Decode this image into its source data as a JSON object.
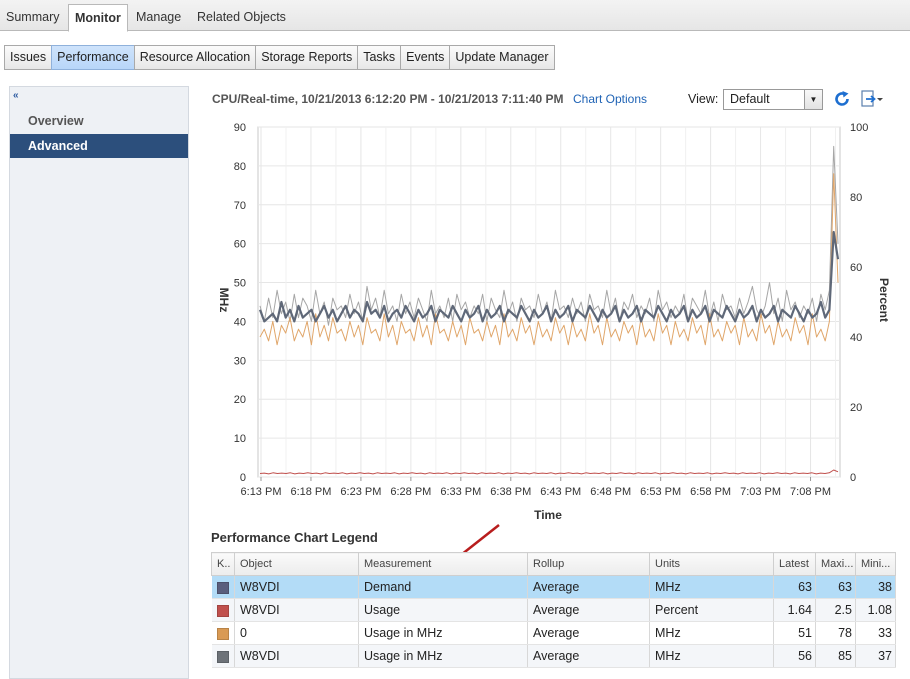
{
  "top_tabs": [
    "Summary",
    "Monitor",
    "Manage",
    "Related Objects"
  ],
  "sub_tabs": [
    "Issues",
    "Performance",
    "Resource Allocation",
    "Storage Reports",
    "Tasks",
    "Events",
    "Update Manager"
  ],
  "left_nav": {
    "collapse_glyph": "«",
    "items": [
      "Overview",
      "Advanced"
    ]
  },
  "chart_header": {
    "title": "CPU/Real-time, 10/21/2013 6:12:20 PM - 10/21/2013 7:11:40 PM",
    "options_link": "Chart Options",
    "view_label": "View:",
    "view_value": "Default",
    "icons": [
      "refresh-icon",
      "export-icon"
    ]
  },
  "legend": {
    "title": "Performance Chart Legend",
    "columns": [
      "K..",
      "Object",
      "Measurement",
      "Rollup",
      "Units",
      "Latest",
      "Maxi...",
      "Mini..."
    ],
    "rows": [
      {
        "color": "#5a5e7d",
        "object": "W8VDI",
        "measurement": "Demand",
        "rollup": "Average",
        "units": "MHz",
        "latest": "63",
        "max": "63",
        "min": "38"
      },
      {
        "color": "#c0504d",
        "object": "W8VDI",
        "measurement": "Usage",
        "rollup": "Average",
        "units": "Percent",
        "latest": "1.64",
        "max": "2.5",
        "min": "1.08"
      },
      {
        "color": "#d99a54",
        "object": "0",
        "measurement": "Usage in MHz",
        "rollup": "Average",
        "units": "MHz",
        "latest": "51",
        "max": "78",
        "min": "33"
      },
      {
        "color": "#6d7278",
        "object": "W8VDI",
        "measurement": "Usage in MHz",
        "rollup": "Average",
        "units": "MHz",
        "latest": "56",
        "max": "85",
        "min": "37"
      }
    ]
  },
  "chart_data": {
    "type": "line",
    "xlabel": "Time",
    "ylabel": "MHz",
    "y2label": "Percent",
    "ylim": [
      0,
      90
    ],
    "yticks": [
      0,
      10,
      20,
      30,
      40,
      50,
      60,
      70,
      80,
      90
    ],
    "y2lim": [
      0,
      100
    ],
    "y2ticks": [
      0,
      20,
      40,
      60,
      80,
      100
    ],
    "xticks": [
      "6:13 PM",
      "6:18 PM",
      "6:23 PM",
      "6:28 PM",
      "6:33 PM",
      "6:38 PM",
      "6:43 PM",
      "6:48 PM",
      "6:53 PM",
      "6:58 PM",
      "7:03 PM",
      "7:08 PM"
    ],
    "grid": true,
    "series": [
      {
        "color": "#a6a6a6",
        "values": [
          44,
          40,
          46,
          41,
          48,
          42,
          45,
          40,
          47,
          41,
          46,
          44,
          40,
          48,
          42,
          45,
          39,
          46,
          43,
          44,
          41,
          47,
          42,
          45,
          40,
          49,
          43,
          46,
          41,
          48,
          42,
          44,
          40,
          47,
          42,
          45,
          41,
          46,
          43,
          40,
          48,
          42,
          44,
          41,
          46,
          40,
          47,
          43,
          45,
          41,
          44,
          42,
          47,
          40,
          46,
          43,
          41,
          48,
          42,
          45,
          40,
          46,
          43,
          44,
          41,
          47,
          42,
          45,
          40,
          48,
          43,
          44,
          41,
          46,
          42,
          45,
          40,
          47,
          43,
          44,
          41,
          48,
          42,
          46,
          40,
          45,
          43,
          47,
          41,
          44,
          42,
          46,
          40,
          48,
          43,
          45,
          41,
          44,
          42,
          47,
          40,
          46,
          44,
          42,
          48,
          41,
          45,
          40,
          47,
          43,
          44,
          41,
          46,
          42,
          45,
          49,
          43,
          41,
          44,
          50,
          42,
          46,
          40,
          48,
          43,
          45,
          41,
          44,
          42,
          46,
          40,
          47,
          43,
          48,
          85,
          60
        ]
      },
      {
        "color": "#e0a66a",
        "values": [
          36,
          38,
          35,
          40,
          34,
          39,
          37,
          41,
          35,
          38,
          36,
          40,
          34,
          42,
          36,
          39,
          35,
          41,
          37,
          38,
          35,
          40,
          36,
          39,
          34,
          41,
          37,
          38,
          35,
          42,
          36,
          39,
          34,
          40,
          37,
          38,
          35,
          41,
          36,
          39,
          34,
          42,
          37,
          38,
          35,
          40,
          36,
          39,
          34,
          41,
          37,
          38,
          35,
          40,
          36,
          39,
          34,
          42,
          36,
          38,
          35,
          41,
          37,
          39,
          34,
          40,
          36,
          38,
          35,
          41,
          37,
          39,
          34,
          40,
          36,
          38,
          35,
          42,
          37,
          39,
          34,
          41,
          36,
          38,
          35,
          40,
          37,
          39,
          34,
          41,
          36,
          38,
          35,
          42,
          37,
          39,
          34,
          40,
          36,
          38,
          35,
          41,
          37,
          39,
          34,
          42,
          36,
          38,
          35,
          40,
          37,
          39,
          34,
          41,
          36,
          38,
          35,
          42,
          37,
          39,
          34,
          40,
          36,
          38,
          35,
          41,
          37,
          39,
          34,
          42,
          36,
          38,
          35,
          40,
          78,
          50
        ]
      },
      {
        "color": "#5f6878",
        "values": [
          43,
          40,
          41,
          42,
          40,
          45,
          41,
          43,
          40,
          44,
          41,
          42,
          43,
          40,
          42,
          44,
          41,
          43,
          40,
          42,
          44,
          41,
          43,
          42,
          40,
          45,
          42,
          43,
          41,
          44,
          40,
          42,
          43,
          41,
          44,
          42,
          40,
          43,
          41,
          42,
          44,
          40,
          43,
          42,
          41,
          44,
          42,
          40,
          43,
          41,
          42,
          44,
          40,
          43,
          41,
          42,
          44,
          40,
          43,
          42,
          41,
          44,
          42,
          40,
          43,
          41,
          42,
          44,
          40,
          43,
          41,
          42,
          44,
          40,
          43,
          42,
          41,
          44,
          42,
          40,
          43,
          41,
          42,
          44,
          40,
          43,
          41,
          42,
          44,
          40,
          43,
          42,
          41,
          44,
          42,
          40,
          43,
          41,
          42,
          44,
          40,
          43,
          41,
          42,
          44,
          40,
          43,
          42,
          41,
          44,
          42,
          40,
          43,
          41,
          42,
          44,
          40,
          43,
          41,
          42,
          44,
          40,
          43,
          42,
          41,
          44,
          42,
          40,
          43,
          41,
          42,
          45,
          41,
          43,
          63,
          56
        ]
      },
      {
        "color": "#c0504d",
        "values": [
          1.0,
          1.1,
          0.9,
          1.2,
          1.0,
          1.1,
          1.0,
          1.2,
          0.9,
          1.1,
          1.0,
          1.2,
          1.0,
          1.1,
          0.9,
          1.2,
          1.0,
          1.1,
          1.0,
          1.2,
          0.9,
          1.1,
          1.0,
          1.2,
          1.0,
          1.1,
          0.9,
          1.2,
          1.0,
          1.1,
          1.0,
          1.2,
          0.9,
          1.1,
          1.0,
          1.2,
          1.0,
          1.1,
          0.9,
          1.2,
          1.0,
          1.1,
          1.0,
          1.2,
          0.9,
          1.1,
          1.0,
          1.2,
          1.0,
          1.1,
          0.9,
          1.2,
          1.0,
          1.1,
          1.0,
          1.2,
          0.9,
          1.1,
          1.0,
          1.2,
          1.0,
          1.1,
          0.9,
          1.2,
          1.0,
          1.1,
          1.0,
          1.2,
          0.9,
          1.1,
          1.0,
          1.2,
          1.0,
          1.1,
          0.9,
          1.2,
          1.0,
          1.1,
          1.0,
          1.2,
          0.9,
          1.1,
          1.0,
          1.2,
          1.0,
          1.1,
          0.9,
          1.2,
          1.0,
          1.1,
          1.0,
          1.2,
          0.9,
          1.1,
          1.0,
          1.2,
          1.0,
          1.1,
          0.9,
          1.2,
          1.0,
          1.1,
          1.0,
          1.2,
          0.9,
          1.1,
          1.0,
          1.2,
          1.0,
          1.1,
          0.9,
          1.2,
          1.0,
          1.1,
          1.0,
          1.2,
          0.9,
          1.1,
          1.0,
          1.2,
          1.0,
          1.1,
          0.9,
          1.2,
          1.0,
          1.1,
          1.0,
          1.2,
          0.9,
          1.1,
          1.0,
          1.2,
          2.0,
          1.5
        ]
      }
    ]
  }
}
